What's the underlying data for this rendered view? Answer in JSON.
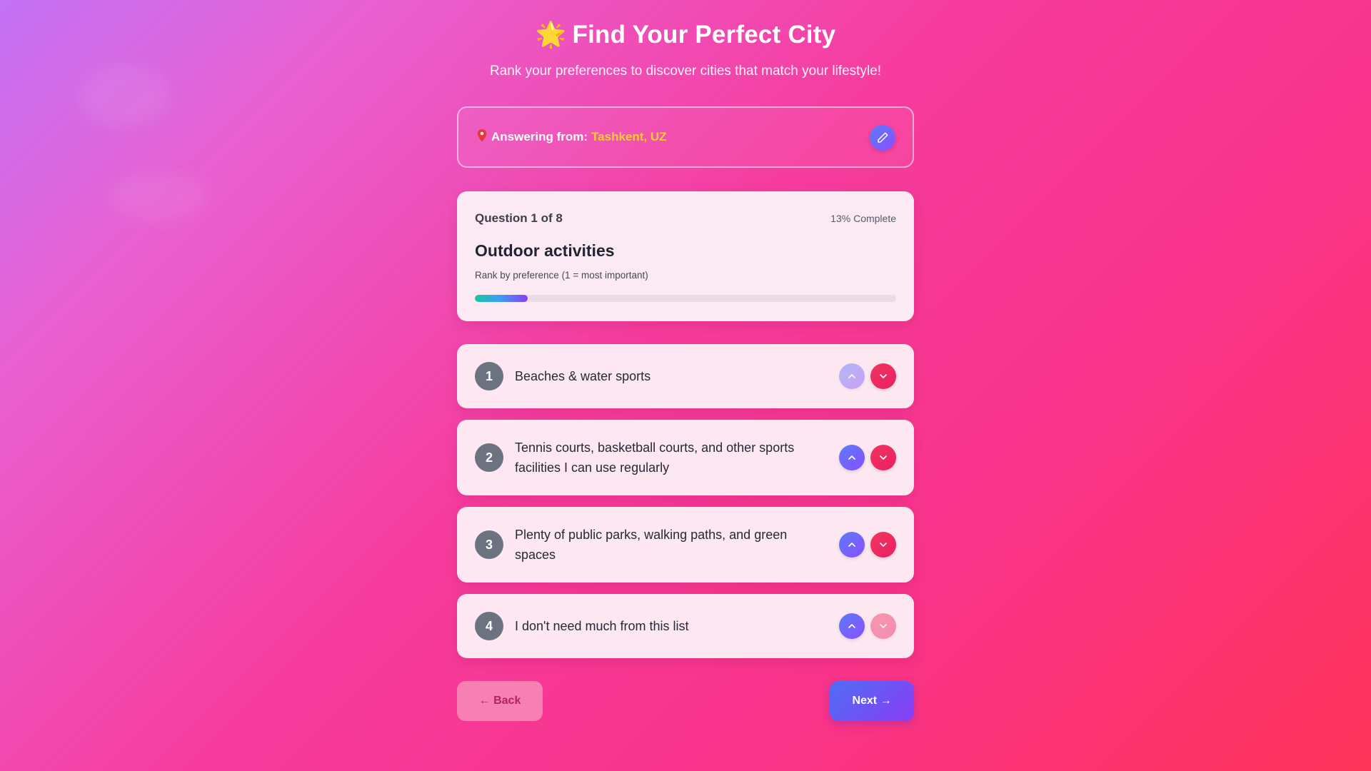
{
  "header": {
    "title_emoji": "🌟",
    "title": "Find Your Perfect City",
    "subtitle": "Rank your preferences to discover cities that match your lifestyle!"
  },
  "location": {
    "label": "Answering from:",
    "value": "Tashkent, UZ",
    "pin_icon": "map-pin-icon",
    "edit_icon": "pencil-icon"
  },
  "question": {
    "counter": "Question 1 of 8",
    "percent_label": "13% Complete",
    "progress_fraction": 0.125,
    "title": "Outdoor activities",
    "hint": "Rank by preference (1 = most important)"
  },
  "options": [
    {
      "rank": "1",
      "label": "Beaches & water sports",
      "up_enabled": false,
      "down_enabled": true
    },
    {
      "rank": "2",
      "label": "Tennis courts, basketball courts, and other sports facilities I can use regularly",
      "up_enabled": true,
      "down_enabled": true
    },
    {
      "rank": "3",
      "label": "Plenty of public parks, walking paths, and green spaces",
      "up_enabled": true,
      "down_enabled": true
    },
    {
      "rank": "4",
      "label": "I don't need much from this list",
      "up_enabled": true,
      "down_enabled": false
    }
  ],
  "nav": {
    "back_label": "← Back",
    "next_label": "Next →"
  },
  "colors": {
    "accent_gradient_start": "#5b7cfa",
    "accent_gradient_end": "#8a4dff",
    "down_button": "#f2365f",
    "location_highlight": "#ffcc33"
  }
}
